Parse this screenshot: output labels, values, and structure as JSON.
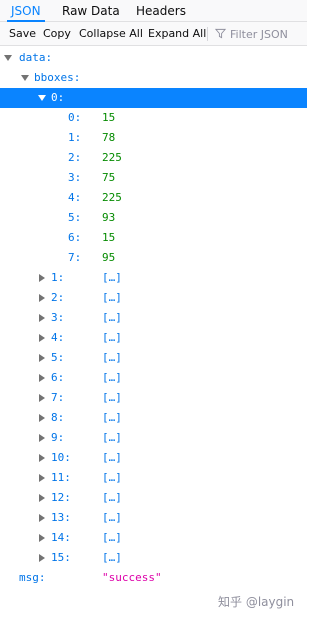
{
  "tabs": {
    "json": "JSON",
    "raw": "Raw Data",
    "headers": "Headers"
  },
  "toolbar": {
    "save": "Save",
    "copy": "Copy",
    "collapse_all": "Collapse All",
    "expand_all": "Expand All",
    "filter_placeholder": "Filter JSON"
  },
  "tree": {
    "data_key": "data:",
    "bboxes_key": "bboxes:",
    "selected_key": "0:",
    "bbox0_values": [
      {
        "key": "0:",
        "value": "15"
      },
      {
        "key": "1:",
        "value": "78"
      },
      {
        "key": "2:",
        "value": "225"
      },
      {
        "key": "3:",
        "value": "75"
      },
      {
        "key": "4:",
        "value": "225"
      },
      {
        "key": "5:",
        "value": "93"
      },
      {
        "key": "6:",
        "value": "15"
      },
      {
        "key": "7:",
        "value": "95"
      }
    ],
    "collapsed_items": [
      {
        "key": "1:",
        "value": "[…]"
      },
      {
        "key": "2:",
        "value": "[…]"
      },
      {
        "key": "3:",
        "value": "[…]"
      },
      {
        "key": "4:",
        "value": "[…]"
      },
      {
        "key": "5:",
        "value": "[…]"
      },
      {
        "key": "6:",
        "value": "[…]"
      },
      {
        "key": "7:",
        "value": "[…]"
      },
      {
        "key": "8:",
        "value": "[…]"
      },
      {
        "key": "9:",
        "value": "[…]"
      },
      {
        "key": "10:",
        "value": "[…]"
      },
      {
        "key": "11:",
        "value": "[…]"
      },
      {
        "key": "12:",
        "value": "[…]"
      },
      {
        "key": "13:",
        "value": "[…]"
      },
      {
        "key": "14:",
        "value": "[…]"
      },
      {
        "key": "15:",
        "value": "[…]"
      }
    ],
    "msg_key": "msg:",
    "msg_value": "\"success\""
  },
  "watermark": "知乎 @laygin",
  "colors": {
    "accent": "#0a84ff",
    "key": "#0074e8",
    "number": "#058b00",
    "string": "#dd00a9"
  }
}
